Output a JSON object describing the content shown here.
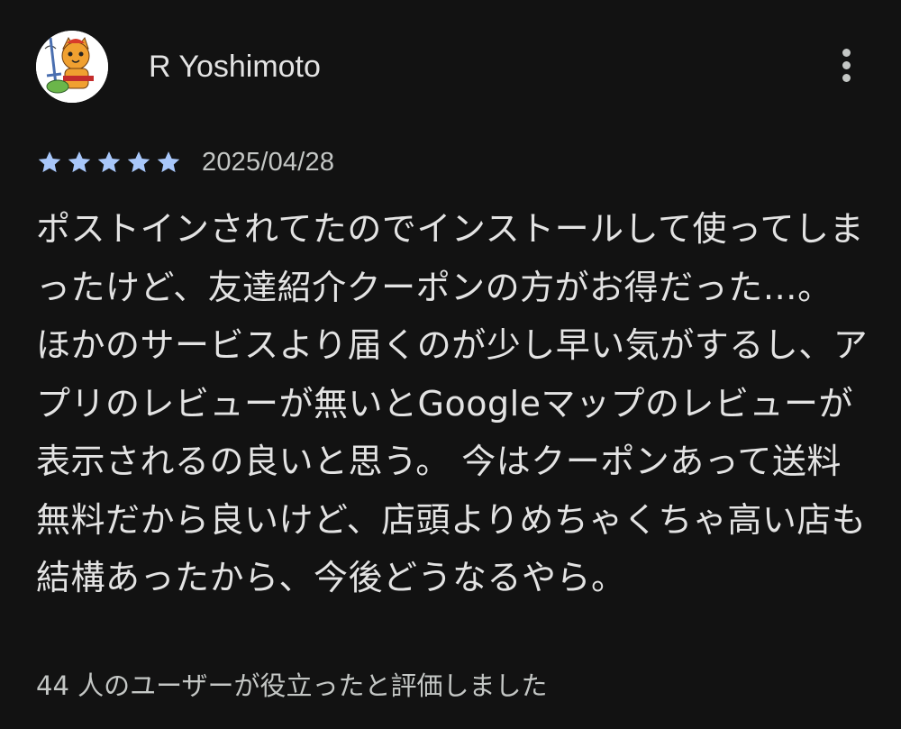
{
  "review": {
    "author": "R Yoshimoto",
    "rating": 5,
    "rating_max": 5,
    "star_color": "#a8c7fa",
    "date": "2025/04/28",
    "text": "ポストインされてたのでインストールして使ってしまったけど、友達紹介クーポンの方がお得だった…。 ほかのサービスより届くのが少し早い気がするし、アプリのレビューが無いとGoogleマップのレビューが表示されるの良いと思う。 今はクーポンあって送料無料だから良いけど、店頭よりめちゃくちゃ高い店も結構あったから、今後どうなるやら。",
    "helpful_text": "44 人のユーザーが役立ったと評価しました",
    "avatar_icon": "cat-avatar-icon",
    "menu_icon": "more-vert-icon"
  }
}
